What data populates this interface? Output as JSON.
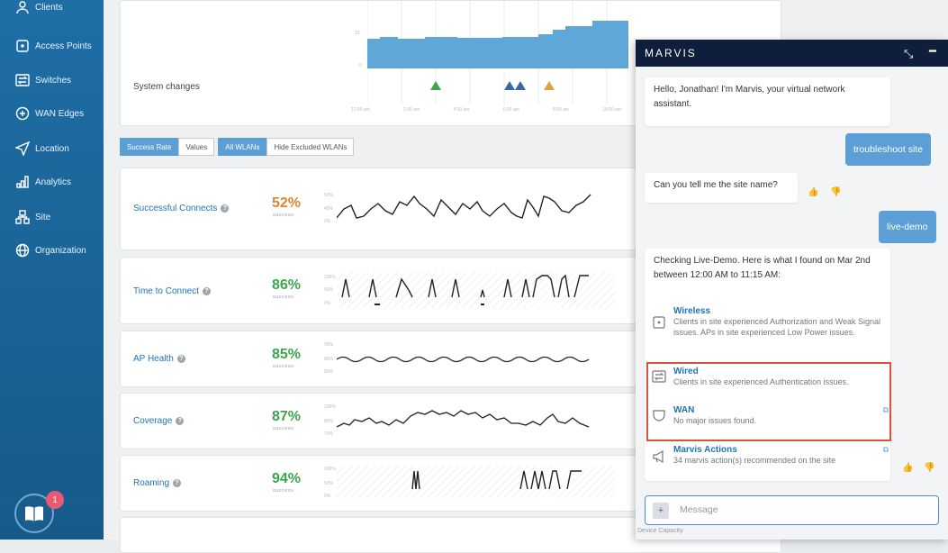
{
  "sidebar": {
    "items": [
      {
        "label": "Clients",
        "icon": "clients-icon"
      },
      {
        "label": "Access Points",
        "icon": "access-point-icon"
      },
      {
        "label": "Switches",
        "icon": "switch-icon"
      },
      {
        "label": "WAN Edges",
        "icon": "wan-edge-icon"
      },
      {
        "label": "Location",
        "icon": "location-icon"
      },
      {
        "label": "Analytics",
        "icon": "analytics-icon"
      },
      {
        "label": "Site",
        "icon": "site-icon"
      },
      {
        "label": "Organization",
        "icon": "organization-icon"
      }
    ],
    "help_badge": "1"
  },
  "main": {
    "system_changes_label": "System changes",
    "timeline_y_ticks": [
      "15",
      "0"
    ],
    "timeline_x_ticks": [
      "12:00 am",
      "2:00 am",
      "4:00 am",
      "6:00 am",
      "8:00 am",
      "10:00 am"
    ],
    "tabs": [
      "Success Rate",
      "Values",
      "All WLANs",
      "Hide Excluded WLANs"
    ],
    "metrics": [
      {
        "label": "Successful Connects",
        "value": "52%",
        "sub": "success",
        "color": "#e0832c",
        "ticks": [
          "50%",
          "45%",
          "0%"
        ]
      },
      {
        "label": "Time to Connect",
        "value": "86%",
        "sub": "success",
        "color": "#3aa64a",
        "ticks": [
          "100%",
          "50%",
          "0%"
        ]
      },
      {
        "label": "AP Health",
        "value": "85%",
        "sub": "success",
        "color": "#3aa64a",
        "ticks": [
          "90%",
          "85%",
          "80%"
        ]
      },
      {
        "label": "Coverage",
        "value": "87%",
        "sub": "success",
        "color": "#3aa64a",
        "ticks": [
          "100%",
          "85%",
          "70%"
        ]
      },
      {
        "label": "Roaming",
        "value": "94%",
        "sub": "success",
        "color": "#3aa64a",
        "ticks": [
          "100%",
          "50%",
          "0%"
        ]
      }
    ]
  },
  "marvis": {
    "title": "MARVIS",
    "messages": {
      "greeting": "Hello, Jonathan! I'm Marvis, your virtual network assistant.",
      "user1": "troubleshoot site",
      "ask_site": "Can you tell me the site name?",
      "user2": "live-demo",
      "summary": "Checking Live-Demo. Here is what I found on Mar 2nd between 12:00 AM to 11:15 AM:"
    },
    "results": [
      {
        "title": "Wireless",
        "desc": "Clients in site experienced Authorization and Weak Signal issues. APs in site experienced Low Power issues."
      },
      {
        "title": "Wired",
        "desc": "Clients in site experienced Authentication issues."
      },
      {
        "title": "WAN",
        "desc": "No major issues found."
      },
      {
        "title": "Marvis Actions",
        "desc": "34 marvis action(s) recommended on the site"
      }
    ],
    "message_placeholder": "Message",
    "bottom_text": "Device Capacity"
  },
  "colors": {
    "accent": "#5b9fd6",
    "sidebar": "#1f6ea6",
    "highlight": "#d9533b",
    "header": "#0f1e3a"
  }
}
